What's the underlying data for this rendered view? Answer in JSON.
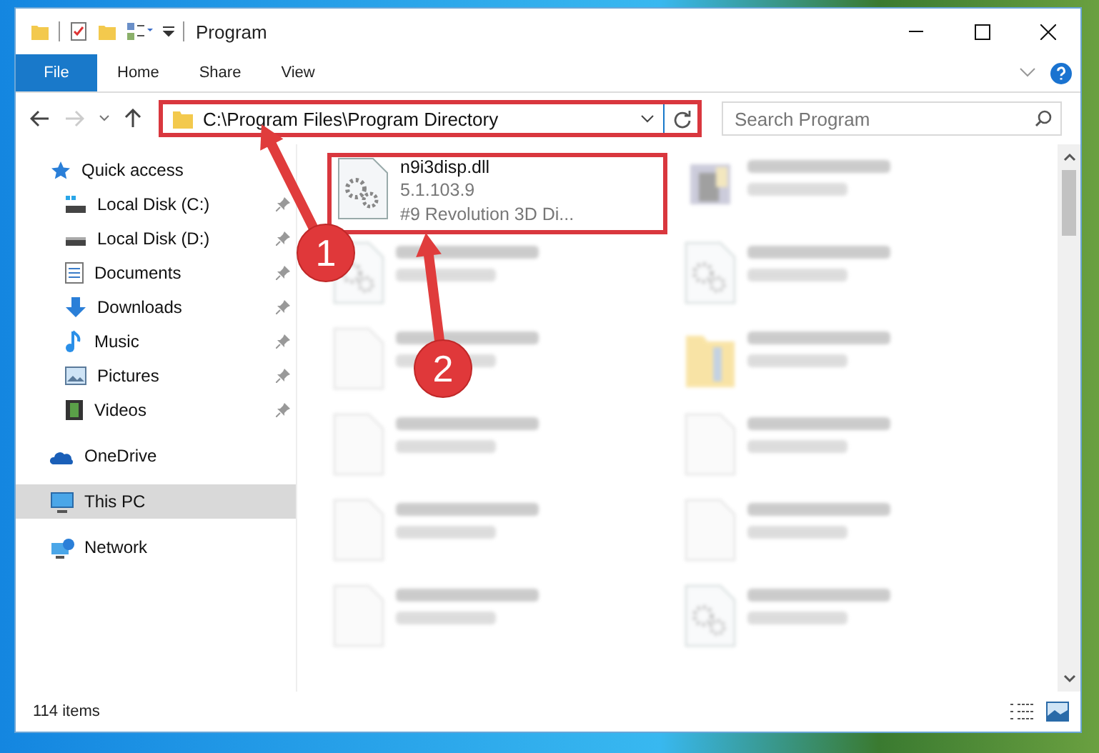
{
  "window": {
    "title": "Program"
  },
  "ribbon_tabs": [
    {
      "label": "File",
      "kind": "file"
    },
    {
      "label": "Home",
      "kind": "tab"
    },
    {
      "label": "Share",
      "kind": "tab"
    },
    {
      "label": "View",
      "kind": "tab"
    }
  ],
  "address": {
    "path": "C:\\Program Files\\Program Directory",
    "highlighted": true
  },
  "search": {
    "placeholder": "Search Program"
  },
  "sidebar": {
    "items": [
      {
        "label": "Quick access",
        "kind": "star",
        "selected": false,
        "children": [
          {
            "label": "Local Disk (C:)",
            "kind": "system-drive",
            "pinned": true,
            "selected": false
          },
          {
            "label": "Local Disk (D:)",
            "kind": "drive",
            "pinned": true,
            "selected": false
          },
          {
            "label": "Documents",
            "kind": "document",
            "pinned": true,
            "selected": false
          },
          {
            "label": "Downloads",
            "kind": "download",
            "pinned": true,
            "selected": false
          },
          {
            "label": "Music",
            "kind": "music",
            "pinned": true,
            "selected": false
          },
          {
            "label": "Pictures",
            "kind": "picture",
            "pinned": true,
            "selected": false
          },
          {
            "label": "Videos",
            "kind": "video",
            "pinned": true,
            "selected": false
          }
        ]
      },
      {
        "label": "OneDrive",
        "kind": "cloud",
        "selected": false
      },
      {
        "label": "This PC",
        "kind": "computer",
        "selected": true
      },
      {
        "label": "Network",
        "kind": "network",
        "selected": false
      }
    ]
  },
  "files": [
    {
      "kind": "settings-file",
      "blurred": false,
      "highlighted": true,
      "name": "n9i3disp.dll",
      "lines": [
        "5.1.103.9",
        "#9 Revolution 3D Di..."
      ]
    },
    {
      "kind": "application",
      "blurred": true,
      "highlighted": false
    },
    {
      "kind": "settings-file",
      "blurred": true,
      "highlighted": false
    },
    {
      "kind": "settings-file",
      "blurred": true,
      "highlighted": false
    },
    {
      "kind": "blank-file",
      "blurred": true,
      "highlighted": false
    },
    {
      "kind": "folder",
      "blurred": true,
      "highlighted": false
    },
    {
      "kind": "blank-file",
      "blurred": true,
      "highlighted": false
    },
    {
      "kind": "blank-file",
      "blurred": true,
      "highlighted": false
    },
    {
      "kind": "blank-file",
      "blurred": true,
      "highlighted": false
    },
    {
      "kind": "blank-file",
      "blurred": true,
      "highlighted": false
    },
    {
      "kind": "blank-file",
      "blurred": true,
      "highlighted": false
    },
    {
      "kind": "settings-file",
      "blurred": true,
      "highlighted": false
    }
  ],
  "callouts": [
    {
      "label": "1"
    },
    {
      "label": "2"
    }
  ],
  "status_bar": {
    "text": "114 items"
  }
}
